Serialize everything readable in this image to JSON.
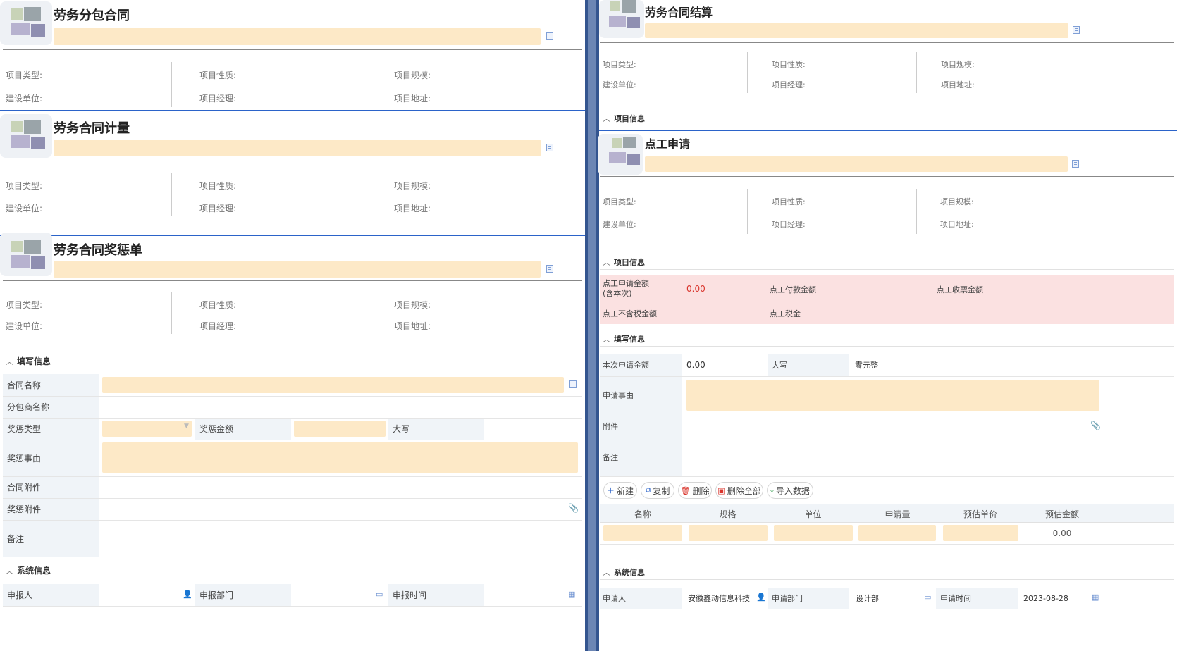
{
  "left": {
    "sections": [
      {
        "title": "劳务分包合同"
      },
      {
        "title": "劳务合同计量"
      },
      {
        "title": "劳务合同奖惩单"
      }
    ],
    "meta": {
      "project_type": "项目类型:",
      "project_nature": "项目性质:",
      "project_scale": "项目规模:",
      "build_unit": "建设单位:",
      "project_manager": "项目经理:",
      "project_address": "项目地址:"
    },
    "fill": {
      "title": "填写信息",
      "contract_name": "合同名称",
      "subcontractor_name": "分包商名称",
      "reward_type": "奖惩类型",
      "reward_amount": "奖惩金额",
      "uppercase": "大写",
      "reward_reason": "奖惩事由",
      "contract_attachment": "合同附件",
      "reward_attachment": "奖惩附件",
      "remark": "备注"
    },
    "system": {
      "title": "系统信息",
      "reporter": "申报人",
      "report_dept": "申报部门",
      "report_time": "申报时间"
    }
  },
  "right": {
    "sections": [
      {
        "title": "劳务合同结算"
      },
      {
        "title": "点工申请"
      }
    ],
    "meta": {
      "project_type": "项目类型:",
      "project_nature": "项目性质:",
      "project_scale": "项目规模:",
      "build_unit": "建设单位:",
      "project_manager": "项目经理:",
      "project_address": "项目地址:"
    },
    "project_info": "项目信息",
    "summary": {
      "apply_amount_label": "点工申请金额",
      "apply_amount_sub": "(含本次)",
      "apply_amount_value": "0.00",
      "pay_amount_label": "点工付款金额",
      "receive_amount_label": "点工收票金额",
      "untaxed_amount_label": "点工不含税金额",
      "tax_label": "点工税金"
    },
    "fill": {
      "title": "填写信息",
      "this_amount_label": "本次申请金额",
      "this_amount_value": "0.00",
      "uppercase_label": "大写",
      "uppercase_value": "零元整",
      "reason_label": "申请事由",
      "attachment_label": "附件",
      "remark_label": "备注"
    },
    "toolbar": {
      "new": "新建",
      "copy": "复制",
      "delete": "删除",
      "delete_all": "删除全部",
      "import": "导入数据"
    },
    "table": {
      "columns": [
        "名称",
        "规格",
        "单位",
        "申请量",
        "预估单价",
        "预估金额"
      ],
      "row_amount": "0.00"
    },
    "system": {
      "title": "系统信息",
      "applicant_label": "申请人",
      "applicant_value": "安徽鑫动信息科技",
      "dept_label": "申请部门",
      "dept_value": "设计部",
      "time_label": "申请时间",
      "time_value": "2023-08-28"
    }
  },
  "colors": {
    "accent": "#2b63c9",
    "field_bg": "#fde9c7",
    "label_bg": "#f0f4f8",
    "summary_bg": "#fbe1e1",
    "amount_red": "#d9342b"
  }
}
